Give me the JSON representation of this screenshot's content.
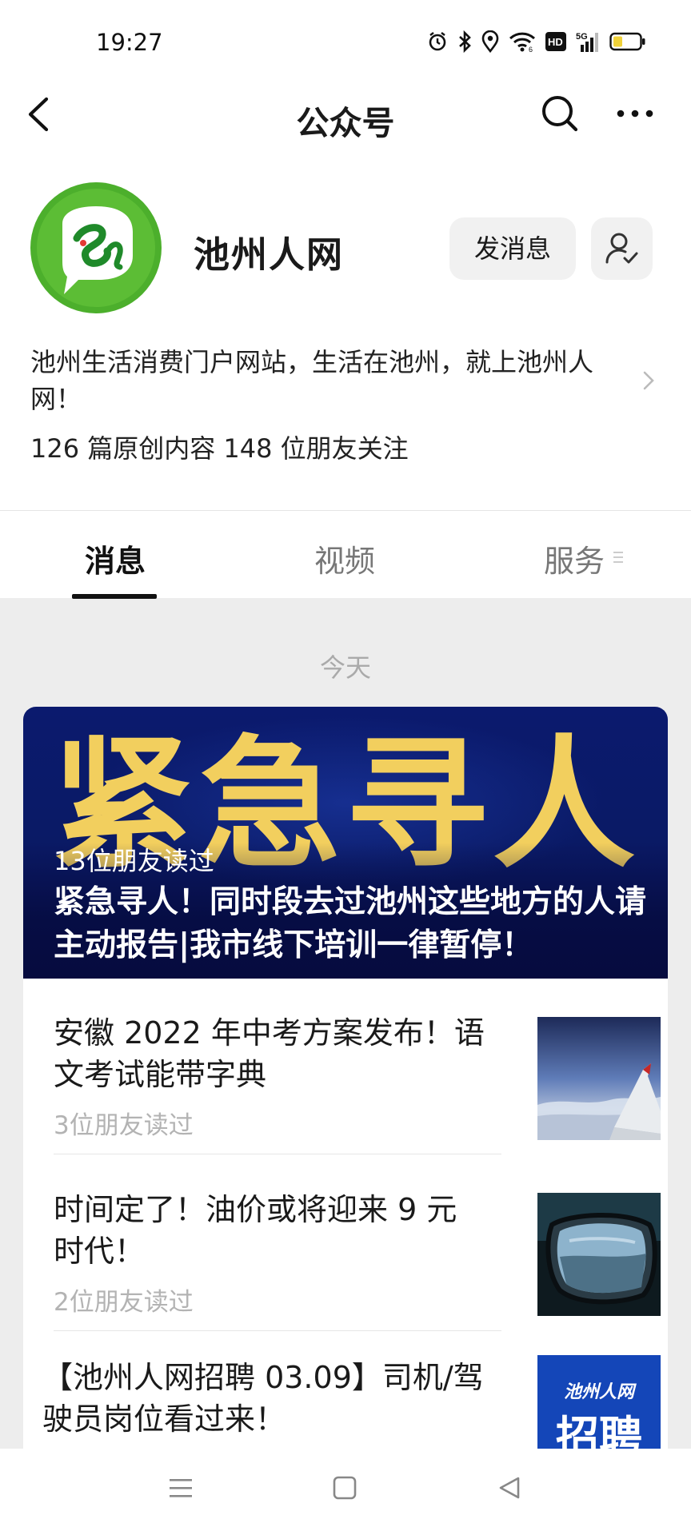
{
  "status_bar": {
    "time": "19:27",
    "icons": [
      "alarm-icon",
      "bluetooth-icon",
      "location-icon",
      "wifi-icon",
      "hd-icon",
      "5g-signal-icon",
      "battery-icon"
    ]
  },
  "nav": {
    "title": "公众号",
    "icons": [
      "back-icon",
      "search-icon",
      "more-icon"
    ]
  },
  "profile": {
    "name": "池州人网",
    "send_message_label": "发消息",
    "description": "池州生活消费门户网站，生活在池州，就上池州人网！",
    "stats": "126 篇原创内容  148 位朋友关注"
  },
  "tabs": [
    {
      "label": "消息",
      "active": true
    },
    {
      "label": "视频",
      "active": false
    },
    {
      "label": "服务",
      "active": false
    }
  ],
  "feed": {
    "date_label": "今天",
    "banner": {
      "big_text": "紧急寻人",
      "reads": "13位朋友读过",
      "title": "紧急寻人！同时段去过池州这些地方的人请主动报告|我市线下培训一律暂停！"
    },
    "items": [
      {
        "title": "安徽 2022 年中考方案发布！语文考试能带字典",
        "reads": "3位朋友读过",
        "thumb": "airplane-wing-thumbnail"
      },
      {
        "title": "时间定了！油价或将迎来 9 元时代！",
        "reads": "2位朋友读过",
        "thumb": "car-mirror-thumbnail"
      },
      {
        "title": "【池州人网招聘 03.09】司机/驾驶员岗位看过来！",
        "reads": "",
        "thumb": "recruitment-thumbnail",
        "thumb_text_top": "池州人网",
        "thumb_text_main": "招聘"
      }
    ]
  },
  "colors": {
    "banner_bg": "#0b1a6e",
    "banner_text": "#f2cf5e",
    "logo_green": "#4caf2c"
  },
  "system_nav": [
    "menu-icon",
    "home-icon",
    "back-triangle-icon"
  ]
}
